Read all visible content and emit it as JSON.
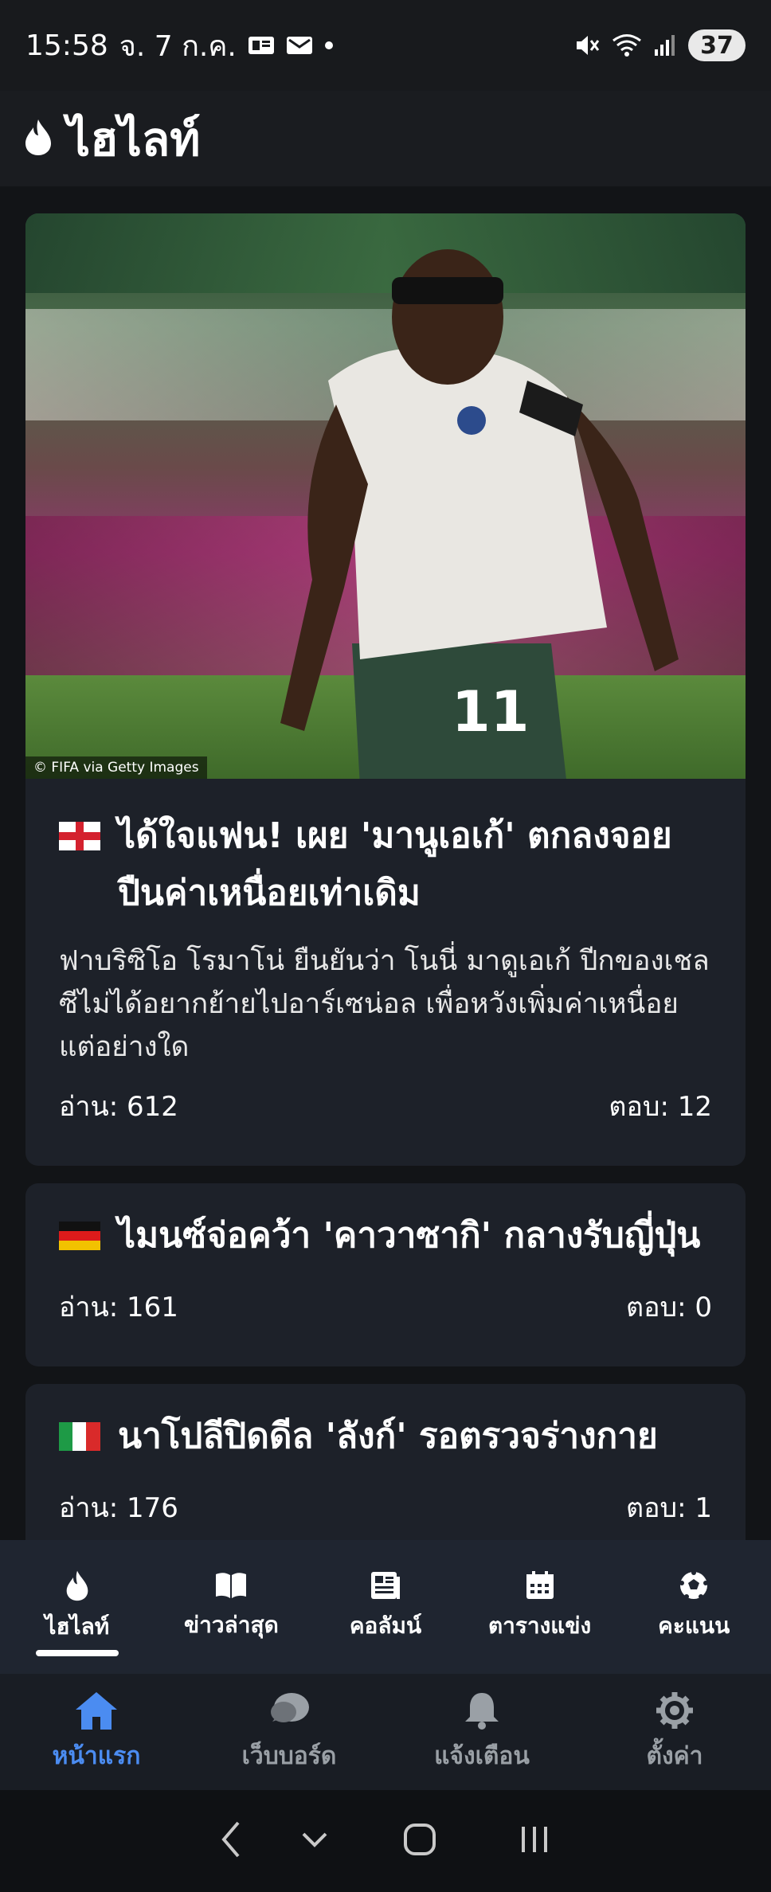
{
  "status": {
    "time": "15:58",
    "date": "จ. 7 ก.ค.",
    "battery": "37"
  },
  "header": {
    "title": "ไฮไลท์"
  },
  "articles": [
    {
      "headline": "ได้ใจแฟน! เผย 'มานูเอเก้' ตกลงจอยปืนค่าเหนื่อยเท่าเดิม",
      "summary": "ฟาบริซิโอ โรมาโน่ ยืนยันว่า โนนี่ มาดูเอเก้ ปีกของเชลซีไม่ได้อยากย้ายไปอาร์เซน่อล เพื่อหวังเพิ่มค่าเหนื่อยแต่อย่างใด",
      "reads": "อ่าน: 612",
      "replies": "ตอบ: 12",
      "image_credit": "© FIFA via Getty Images",
      "flag": "england"
    },
    {
      "headline": "ไมนซ์จ่อคว้า 'คาวาซากิ' กลางรับญี่ปุ่น",
      "reads": "อ่าน: 161",
      "replies": "ตอบ: 0",
      "flag": "germany"
    },
    {
      "headline": "นาโปลีปิดดีล 'ลังก์' รอตรวจร่างกาย",
      "reads": "อ่าน: 176",
      "replies": "ตอบ: 1",
      "flag": "italy"
    }
  ],
  "tabs": [
    {
      "label": "ไฮไลท์",
      "icon": "fire-icon",
      "active": true
    },
    {
      "label": "ข่าวล่าสุด",
      "icon": "book-icon"
    },
    {
      "label": "คอลัมน์",
      "icon": "newspaper-icon"
    },
    {
      "label": "ตารางแข่ง",
      "icon": "calendar-icon"
    },
    {
      "label": "คะแนน",
      "icon": "soccer-ball-icon"
    }
  ],
  "bottom_nav": [
    {
      "label": "หน้าแรก",
      "icon": "home-icon",
      "active": true
    },
    {
      "label": "เว็บบอร์ด",
      "icon": "chat-icon"
    },
    {
      "label": "แจ้งเตือน",
      "icon": "bell-icon"
    },
    {
      "label": "ตั้งค่า",
      "icon": "gear-icon"
    }
  ],
  "colors": {
    "accent": "#4b8cf1",
    "card": "#1d2129",
    "background": "#121417"
  }
}
